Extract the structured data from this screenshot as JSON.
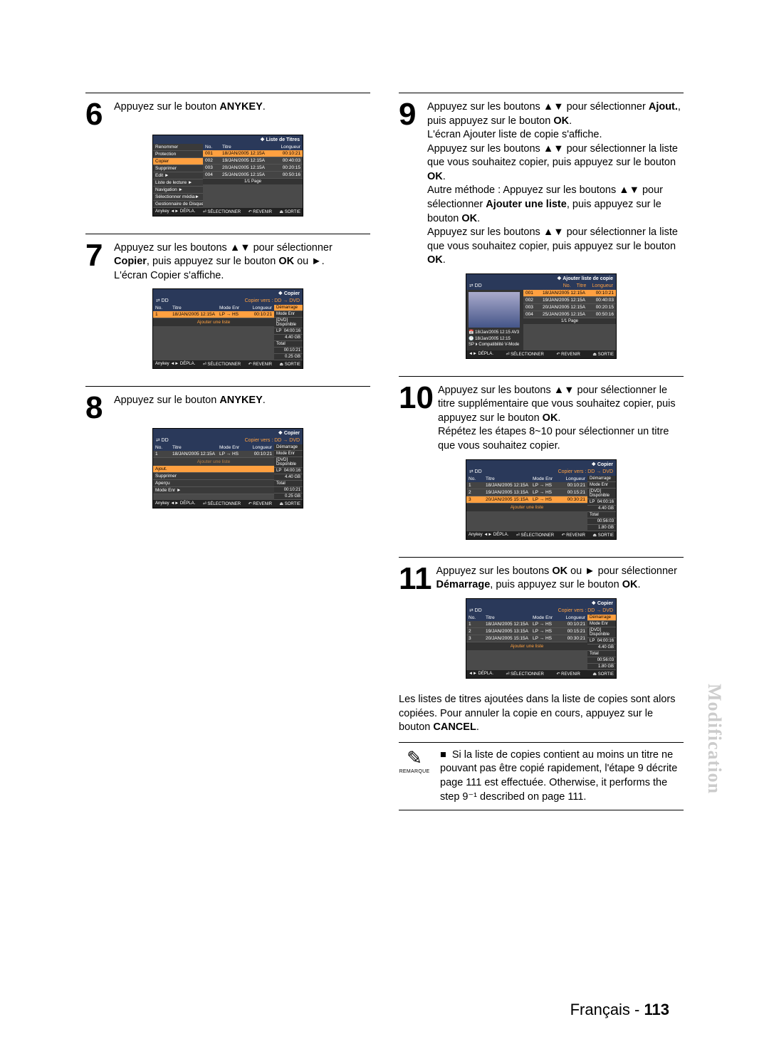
{
  "section_tab": "Modification",
  "footer": {
    "lang": "Français -",
    "page": "113"
  },
  "note_label": "REMARQUE",
  "note_text": "Si la liste de copies contient au moins un titre ne pouvant pas être copié rapidement, l'étape 9 décrite page 111 est effectuée. Otherwise, it performs the step 9⁻¹ described on page 111.",
  "glyphs": {
    "up": "▲",
    "down": "▼",
    "right": "►",
    "move": "◄ ► ▲ ▼",
    "ok": "⏎",
    "ret": "↶",
    "exit": "⏏",
    "bullet": "❖",
    "note": "✎",
    "sq": "■"
  },
  "osd_common": {
    "depla": "DÉPLA.",
    "select": "SÉLECTIONNER",
    "revenir": "REVENIR",
    "sortie": "SORTIE",
    "anykey": "Anykey",
    "dd": "DD",
    "page11": "1/1 Page",
    "copier_title": "Copier",
    "copier_vers": "Copier vers : DD → DVD",
    "ajouter_title": "Ajouter liste de copie",
    "cols": {
      "no": "No.",
      "titre": "Titre",
      "mode": "Mode Enr",
      "longueur": "Longueur"
    },
    "ajouter_une_liste": "Ajouter une liste",
    "demarrage": "Démarrage",
    "mode_enr": "Mode Enr",
    "dvd_dispo": "[DVD] Disponible",
    "total": "Total",
    "lp": "LP"
  },
  "steps": {
    "6": {
      "num": "6",
      "text_a": "Appuyez sur le bouton ",
      "text_b": "ANYKEY",
      "text_c": ".",
      "osd": {
        "title": "Liste de Titres",
        "cols": [
          "No.",
          "Titre",
          "Longueur"
        ],
        "menu": [
          "Renommer",
          "Protection",
          "Copier",
          "Supprimer",
          "Edit",
          "Liste de lecture",
          "Navigation",
          "Sélectionner média",
          "Gestionnaire de Disque"
        ],
        "menu_hl": "Copier",
        "rows": [
          {
            "no": "001",
            "t": "18/JAN/2005 12:15A",
            "l": "00:10:21",
            "hl": true
          },
          {
            "no": "002",
            "t": "19/JAN/2005 12:15A",
            "l": "00:40:03"
          },
          {
            "no": "003",
            "t": "20/JAN/2005 12:15A",
            "l": "00:20:15"
          },
          {
            "no": "004",
            "t": "25/JAN/2005 12:15A",
            "l": "00:50:16"
          }
        ]
      }
    },
    "7": {
      "num": "7",
      "text": "Appuyez sur les boutons ▲▼ pour sélectionner Copier, puis appuyez sur le bouton OK ou ►.\nL'écran Copier s'affiche.",
      "text_html_a": "Appuyez sur les boutons ",
      "text_html_b": " pour sélectionner ",
      "text_html_c": "Copier",
      "text_html_d": ", puis appuyez sur le bouton ",
      "text_html_e": "OK",
      "text_html_f": " ou ",
      "text_html_g": "L'écran Copier s'affiche.",
      "osd": {
        "rows": [
          {
            "no": "1",
            "t": "18/JAN/2005 12:15A",
            "m": "LP → HS",
            "l": "00:10:21",
            "hl": true
          }
        ],
        "side": [
          "04:00:16",
          "4.40 GB",
          "00:10:21",
          "0.25 GB"
        ]
      }
    },
    "8": {
      "num": "8",
      "text_a": "Appuyez sur le bouton ",
      "text_b": "ANYKEY",
      "text_c": ".",
      "osd": {
        "menu": [
          "Ajout.",
          "Supprimer",
          "Aperçu",
          "Mode Enr"
        ],
        "menu_hl": "Ajout.",
        "rows": [
          {
            "no": "1",
            "t": "18/JAN/2005 12:15A",
            "m": "LP → HS",
            "l": "00:10:21"
          }
        ],
        "side": [
          "04:00:16",
          "4.40 GB",
          "00:10:21",
          "0.25 GB"
        ]
      }
    },
    "9": {
      "num": "9",
      "p1a": "Appuyez sur les boutons ",
      "p1b": " pour sélectionner ",
      "p1c": "Ajout.",
      "p1d": ", puis appuyez sur le bouton ",
      "p1e": "OK",
      "p1f": ".",
      "p2": "L'écran Ajouter liste de copie s'affiche.",
      "p3a": "Appuyez sur les boutons ",
      "p3b": " pour sélectionner la liste que vous souhaitez copier, puis appuyez sur le bouton ",
      "p3c": "OK",
      "p3d": ".",
      "p4a": "Autre méthode : Appuyez sur les boutons ",
      "p4b": " pour sélectionner ",
      "p4c": "Ajouter une liste",
      "p4d": ", puis appuyez sur le bouton ",
      "p4e": "OK",
      "p4f": ".",
      "p5a": "Appuyez sur les boutons ",
      "p5b": " pour sélectionner la liste que vous souhaitez copier, puis appuyez sur le bouton ",
      "p5c": "OK",
      "p5d": ".",
      "osd": {
        "thumb_info": [
          "18/Jan/2005 12:15 AV3",
          "18/Jan/2005 12:15",
          "SP ⏵ Compatibilité V-Mode"
        ],
        "cols": [
          "No.",
          "Titre",
          "Longueur"
        ],
        "rows": [
          {
            "no": "001",
            "t": "18/JAN/2005 12:15A",
            "l": "00:10:21",
            "hl": true
          },
          {
            "no": "002",
            "t": "19/JAN/2005 12:15A",
            "l": "00:40:03"
          },
          {
            "no": "003",
            "t": "20/JAN/2005 12:15A",
            "l": "00:20:15"
          },
          {
            "no": "004",
            "t": "25/JAN/2005 12:15A",
            "l": "00:50:16"
          }
        ]
      }
    },
    "10": {
      "num": "10",
      "p1a": "Appuyez sur les boutons ",
      "p1b": " pour sélectionner le titre supplémentaire que vous souhaitez copier, puis appuyez sur le bouton ",
      "p1c": "OK",
      "p1d": ".",
      "p2": "Répétez les étapes 8~10 pour sélectionner un titre que vous souhaitez copier.",
      "osd": {
        "rows": [
          {
            "no": "1",
            "t": "18/JAN/2005 12:15A",
            "m": "LP → HS",
            "l": "00:10:21"
          },
          {
            "no": "2",
            "t": "19/JAN/2005 13:15A",
            "m": "LP → HS",
            "l": "00:15:21"
          },
          {
            "no": "3",
            "t": "20/JAN/2005 15:15A",
            "m": "LP → HS",
            "l": "00:30:21",
            "hl": true
          }
        ],
        "side": [
          "04:00:16",
          "4.40 GB",
          "00:56:03",
          "1.80 GB"
        ]
      }
    },
    "11": {
      "num": "11",
      "p1a": "Appuyez sur les boutons ",
      "p1b": "OK",
      "p1c": " ou ",
      "p1d": " pour sélectionner ",
      "p1e": "Démarrage",
      "p1f": ", puis appuyez sur le bouton ",
      "p1g": "OK",
      "p1h": ".",
      "p2a": "Les listes de titres ajoutées dans la liste de copies sont alors copiées. Pour annuler la copie en cours, appuyez sur le bouton ",
      "p2b": "CANCEL",
      "p2c": ".",
      "osd": {
        "rows": [
          {
            "no": "1",
            "t": "18/JAN/2005 12:15A",
            "m": "LP → HS",
            "l": "00:10:21"
          },
          {
            "no": "2",
            "t": "19/JAN/2005 13:15A",
            "m": "LP → HS",
            "l": "00:15:21"
          },
          {
            "no": "3",
            "t": "20/JAN/2005 15:15A",
            "m": "LP → HS",
            "l": "00:30:21"
          }
        ],
        "side": [
          "04:00:16",
          "4.40 GB",
          "00:56:03",
          "1.80 GB"
        ]
      }
    }
  }
}
